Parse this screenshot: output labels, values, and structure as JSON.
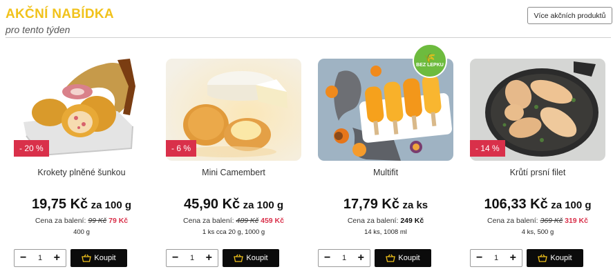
{
  "header": {
    "title": "AKČNÍ NABÍDKA",
    "subtitle": "pro tento týden",
    "more_button": "Více akčních produktů"
  },
  "colors": {
    "accent": "#f1c21b",
    "discount_bg": "#d9304a",
    "buy_bg": "#0b0b0b",
    "gluten_free_badge": "#6dbb3e"
  },
  "products": [
    {
      "discount": "- 20 %",
      "name": "Krokety plněné šunkou",
      "price": "19,75 Kč",
      "price_unit": "za 100 g",
      "pack_label": "Cena za balení:",
      "pack_old": "99 Kč",
      "pack_new": "79 Kč",
      "meta": "400 g",
      "qty": "1",
      "buy_label": "Koupit",
      "image_icon": "croquettes-ham-image"
    },
    {
      "discount": "- 6 %",
      "name": "Mini Camembert",
      "price": "45,90 Kč",
      "price_unit": "za 100 g",
      "pack_label": "Cena za balení:",
      "pack_old": "489 Kč",
      "pack_new": "459 Kč",
      "meta": "1 ks cca 20 g, 1000 g",
      "qty": "1",
      "buy_label": "Koupit",
      "image_icon": "camembert-image"
    },
    {
      "discount": "",
      "name": "Multifit",
      "price": "17,79 Kč",
      "price_unit": "za ks",
      "pack_label": "Cena za balení:",
      "pack_price": "249 Kč",
      "meta": "14 ks, 1008 ml",
      "qty": "1",
      "buy_label": "Koupit",
      "image_icon": "ice-pops-image",
      "badge": "BEZ LEPKU"
    },
    {
      "discount": "- 14 %",
      "name": "Krůtí prsní filet",
      "price": "106,33 Kč",
      "price_unit": "za 100 g",
      "pack_label": "Cena za balení:",
      "pack_old": "369 Kč",
      "pack_new": "319 Kč",
      "meta": "4 ks, 500 g",
      "qty": "1",
      "buy_label": "Koupit",
      "image_icon": "turkey-fillet-image"
    }
  ]
}
